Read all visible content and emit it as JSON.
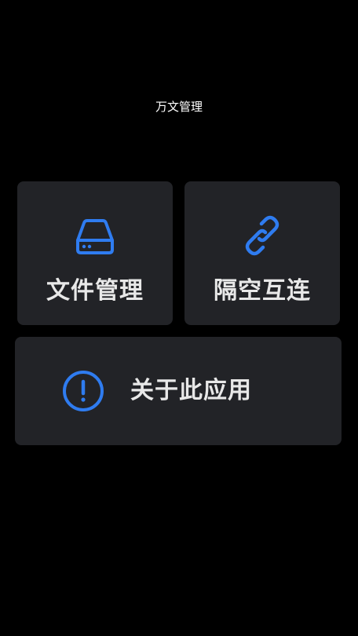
{
  "app": {
    "title": "万文管理"
  },
  "tiles": {
    "file_manager": {
      "label": "文件管理",
      "icon": "hard-drive-icon"
    },
    "air_link": {
      "label": "隔空互连",
      "icon": "link-icon"
    },
    "about": {
      "label": "关于此应用",
      "icon": "alert-circle-icon"
    }
  },
  "colors": {
    "background": "#000000",
    "tile": "#222327",
    "accent": "#2f7cf0",
    "label": "#e8e8e8"
  }
}
